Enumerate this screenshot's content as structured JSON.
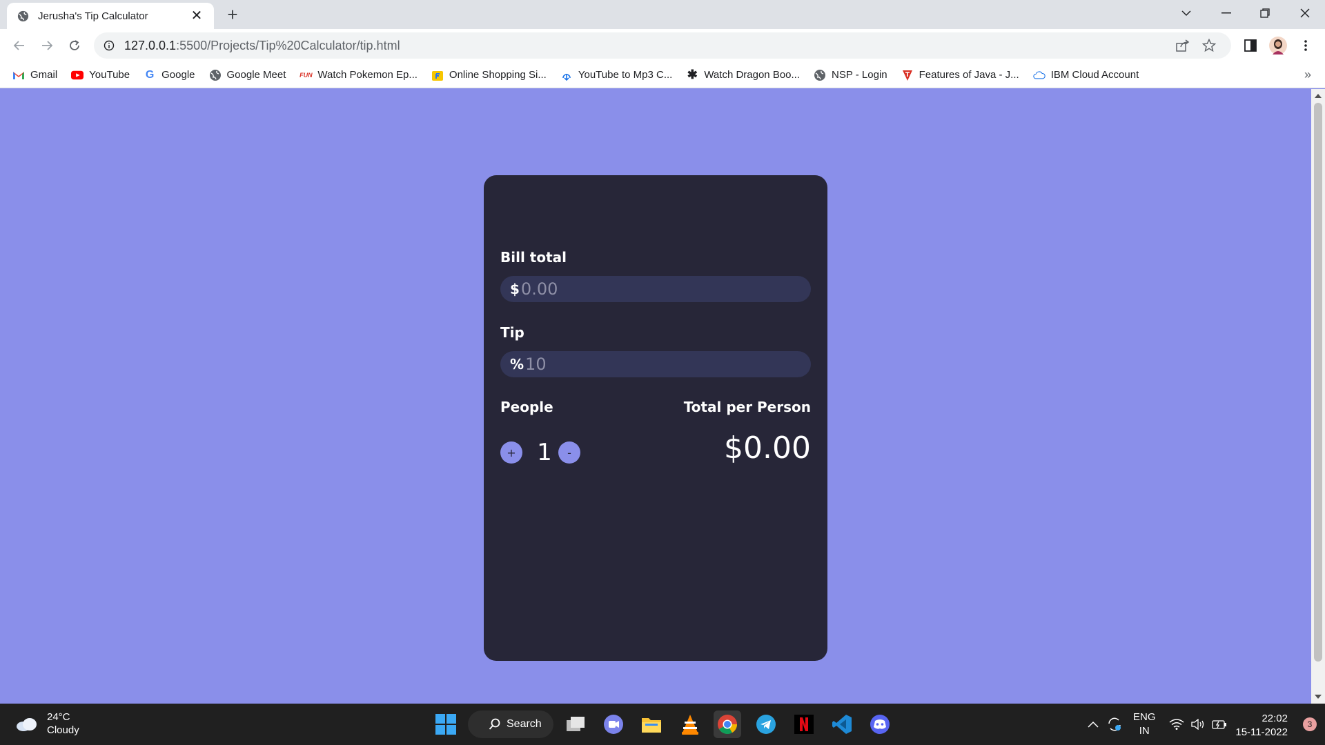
{
  "browser": {
    "tab_title": "Jerusha's Tip Calculator",
    "url_host": "127.0.0.1",
    "url_path": ":5500/Projects/Tip%20Calculator/tip.html",
    "bookmarks": [
      {
        "label": "Gmail",
        "icon": "gmail-icon"
      },
      {
        "label": "YouTube",
        "icon": "youtube-icon"
      },
      {
        "label": "Google",
        "icon": "google-icon"
      },
      {
        "label": "Google Meet",
        "icon": "globe-icon"
      },
      {
        "label": "Watch Pokemon Ep...",
        "icon": "pokemon-site-icon"
      },
      {
        "label": "Online Shopping Si...",
        "icon": "flipkart-icon"
      },
      {
        "label": "YouTube to Mp3 C...",
        "icon": "download-icon"
      },
      {
        "label": "Watch Dragon Boo...",
        "icon": "dragon-site-icon"
      },
      {
        "label": "NSP - Login",
        "icon": "globe-icon"
      },
      {
        "label": "Features of Java - J...",
        "icon": "javatpoint-icon"
      },
      {
        "label": "IBM Cloud Account",
        "icon": "cloud-icon"
      }
    ],
    "more_bookmarks": "»"
  },
  "calculator": {
    "bill_label": "Bill total",
    "bill_prefix": "$",
    "bill_placeholder": "0.00",
    "tip_label": "Tip",
    "tip_prefix": "%",
    "tip_placeholder": "10",
    "people_label": "People",
    "people_count": "1",
    "plus_label": "+",
    "minus_label": "-",
    "total_label": "Total per Person",
    "total_value": "$0.00"
  },
  "taskbar": {
    "temperature": "24°C",
    "condition": "Cloudy",
    "search_label": "Search",
    "language_1": "ENG",
    "language_2": "IN",
    "time": "22:02",
    "date": "15-11-2022",
    "notifications": "3"
  },
  "colors": {
    "page_background": "#8a8fea",
    "card_background": "#272638",
    "input_background": "#333657",
    "accent": "#8a8fea"
  }
}
